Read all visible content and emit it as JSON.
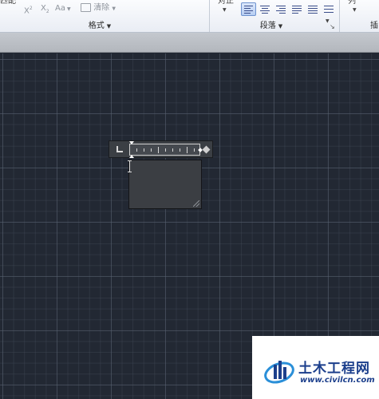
{
  "ribbon": {
    "format_group": {
      "title": "格式",
      "left_label": "匹配",
      "superscript": "X",
      "subscript": "X",
      "case_label": "Aa",
      "clear_label": "清除"
    },
    "paragraph_group": {
      "title": "段落",
      "align_label": "对正"
    },
    "insert_group": {
      "title": "插",
      "column_label": "列"
    }
  },
  "editor": {
    "state": "in-place text editing"
  },
  "watermark": {
    "title": "土木工程网",
    "url": "www.civilcn.com",
    "colors": {
      "primary": "#1c3f8c",
      "accent": "#2a8fd8"
    }
  }
}
